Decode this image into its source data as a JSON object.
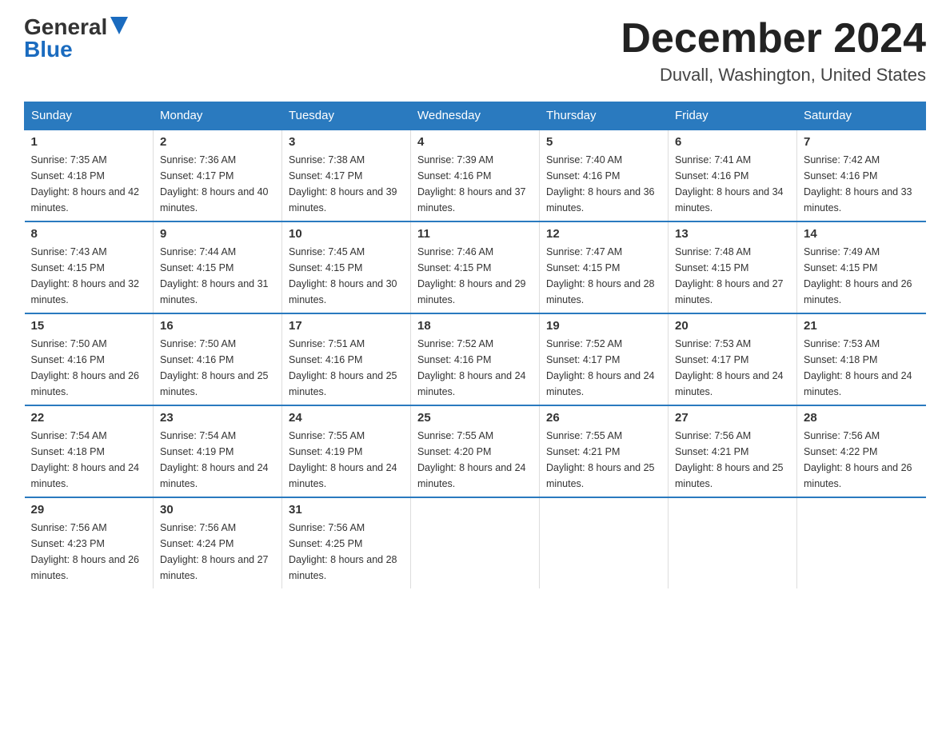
{
  "logo": {
    "general": "General",
    "blue": "Blue"
  },
  "header": {
    "month": "December 2024",
    "location": "Duvall, Washington, United States"
  },
  "days_of_week": [
    "Sunday",
    "Monday",
    "Tuesday",
    "Wednesday",
    "Thursday",
    "Friday",
    "Saturday"
  ],
  "weeks": [
    [
      {
        "day": "1",
        "sunrise": "7:35 AM",
        "sunset": "4:18 PM",
        "daylight": "8 hours and 42 minutes."
      },
      {
        "day": "2",
        "sunrise": "7:36 AM",
        "sunset": "4:17 PM",
        "daylight": "8 hours and 40 minutes."
      },
      {
        "day": "3",
        "sunrise": "7:38 AM",
        "sunset": "4:17 PM",
        "daylight": "8 hours and 39 minutes."
      },
      {
        "day": "4",
        "sunrise": "7:39 AM",
        "sunset": "4:16 PM",
        "daylight": "8 hours and 37 minutes."
      },
      {
        "day": "5",
        "sunrise": "7:40 AM",
        "sunset": "4:16 PM",
        "daylight": "8 hours and 36 minutes."
      },
      {
        "day": "6",
        "sunrise": "7:41 AM",
        "sunset": "4:16 PM",
        "daylight": "8 hours and 34 minutes."
      },
      {
        "day": "7",
        "sunrise": "7:42 AM",
        "sunset": "4:16 PM",
        "daylight": "8 hours and 33 minutes."
      }
    ],
    [
      {
        "day": "8",
        "sunrise": "7:43 AM",
        "sunset": "4:15 PM",
        "daylight": "8 hours and 32 minutes."
      },
      {
        "day": "9",
        "sunrise": "7:44 AM",
        "sunset": "4:15 PM",
        "daylight": "8 hours and 31 minutes."
      },
      {
        "day": "10",
        "sunrise": "7:45 AM",
        "sunset": "4:15 PM",
        "daylight": "8 hours and 30 minutes."
      },
      {
        "day": "11",
        "sunrise": "7:46 AM",
        "sunset": "4:15 PM",
        "daylight": "8 hours and 29 minutes."
      },
      {
        "day": "12",
        "sunrise": "7:47 AM",
        "sunset": "4:15 PM",
        "daylight": "8 hours and 28 minutes."
      },
      {
        "day": "13",
        "sunrise": "7:48 AM",
        "sunset": "4:15 PM",
        "daylight": "8 hours and 27 minutes."
      },
      {
        "day": "14",
        "sunrise": "7:49 AM",
        "sunset": "4:15 PM",
        "daylight": "8 hours and 26 minutes."
      }
    ],
    [
      {
        "day": "15",
        "sunrise": "7:50 AM",
        "sunset": "4:16 PM",
        "daylight": "8 hours and 26 minutes."
      },
      {
        "day": "16",
        "sunrise": "7:50 AM",
        "sunset": "4:16 PM",
        "daylight": "8 hours and 25 minutes."
      },
      {
        "day": "17",
        "sunrise": "7:51 AM",
        "sunset": "4:16 PM",
        "daylight": "8 hours and 25 minutes."
      },
      {
        "day": "18",
        "sunrise": "7:52 AM",
        "sunset": "4:16 PM",
        "daylight": "8 hours and 24 minutes."
      },
      {
        "day": "19",
        "sunrise": "7:52 AM",
        "sunset": "4:17 PM",
        "daylight": "8 hours and 24 minutes."
      },
      {
        "day": "20",
        "sunrise": "7:53 AM",
        "sunset": "4:17 PM",
        "daylight": "8 hours and 24 minutes."
      },
      {
        "day": "21",
        "sunrise": "7:53 AM",
        "sunset": "4:18 PM",
        "daylight": "8 hours and 24 minutes."
      }
    ],
    [
      {
        "day": "22",
        "sunrise": "7:54 AM",
        "sunset": "4:18 PM",
        "daylight": "8 hours and 24 minutes."
      },
      {
        "day": "23",
        "sunrise": "7:54 AM",
        "sunset": "4:19 PM",
        "daylight": "8 hours and 24 minutes."
      },
      {
        "day": "24",
        "sunrise": "7:55 AM",
        "sunset": "4:19 PM",
        "daylight": "8 hours and 24 minutes."
      },
      {
        "day": "25",
        "sunrise": "7:55 AM",
        "sunset": "4:20 PM",
        "daylight": "8 hours and 24 minutes."
      },
      {
        "day": "26",
        "sunrise": "7:55 AM",
        "sunset": "4:21 PM",
        "daylight": "8 hours and 25 minutes."
      },
      {
        "day": "27",
        "sunrise": "7:56 AM",
        "sunset": "4:21 PM",
        "daylight": "8 hours and 25 minutes."
      },
      {
        "day": "28",
        "sunrise": "7:56 AM",
        "sunset": "4:22 PM",
        "daylight": "8 hours and 26 minutes."
      }
    ],
    [
      {
        "day": "29",
        "sunrise": "7:56 AM",
        "sunset": "4:23 PM",
        "daylight": "8 hours and 26 minutes."
      },
      {
        "day": "30",
        "sunrise": "7:56 AM",
        "sunset": "4:24 PM",
        "daylight": "8 hours and 27 minutes."
      },
      {
        "day": "31",
        "sunrise": "7:56 AM",
        "sunset": "4:25 PM",
        "daylight": "8 hours and 28 minutes."
      },
      null,
      null,
      null,
      null
    ]
  ],
  "labels": {
    "sunrise": "Sunrise: ",
    "sunset": "Sunset: ",
    "daylight": "Daylight: "
  }
}
